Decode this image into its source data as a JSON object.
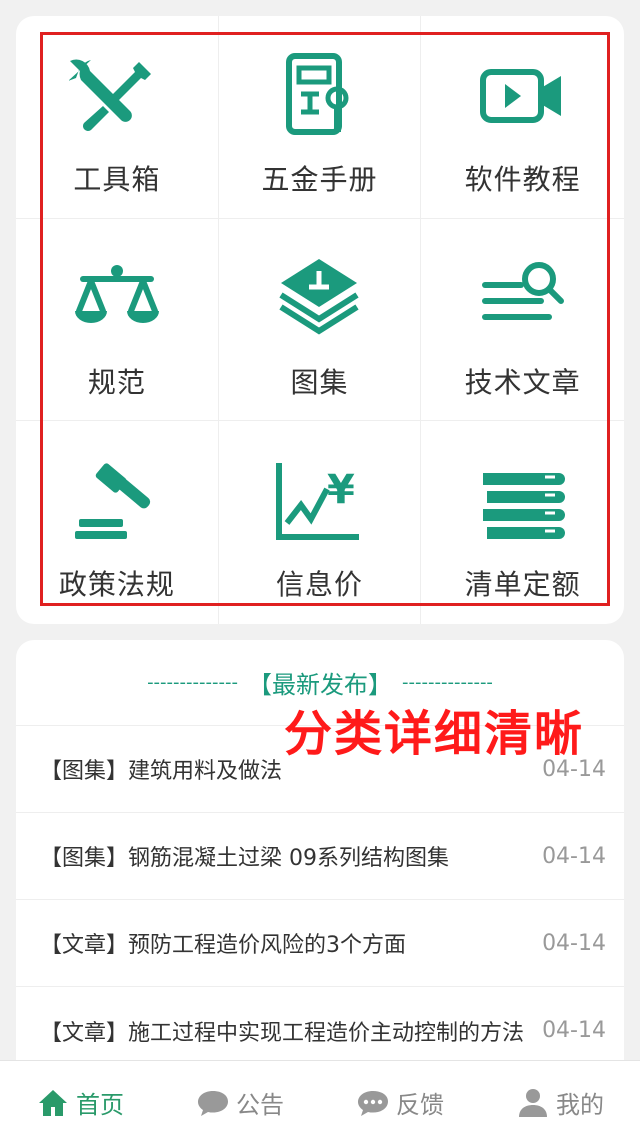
{
  "grid": {
    "items": [
      {
        "label": "工具箱",
        "icon": "toolbox-icon"
      },
      {
        "label": "五金手册",
        "icon": "hardware-manual-icon"
      },
      {
        "label": "软件教程",
        "icon": "video-tutorial-icon"
      },
      {
        "label": "规范",
        "icon": "balance-scale-icon"
      },
      {
        "label": "图集",
        "icon": "layered-atlas-icon"
      },
      {
        "label": "技术文章",
        "icon": "article-search-icon"
      },
      {
        "label": "政策法规",
        "icon": "gavel-icon"
      },
      {
        "label": "信息价",
        "icon": "price-chart-icon"
      },
      {
        "label": "清单定额",
        "icon": "book-stack-icon"
      }
    ]
  },
  "news": {
    "title": "【最新发布】",
    "dashes": "--------------",
    "overlay": "分类详细清晰",
    "items": [
      {
        "text": "【图集】建筑用料及做法",
        "date": "04-14"
      },
      {
        "text": "【图集】钢筋混凝土过梁 09系列结构图集",
        "date": "04-14"
      },
      {
        "text": "【文章】预防工程造价风险的3个方面",
        "date": "04-14"
      },
      {
        "text": "【文章】施工过程中实现工程造价主动控制的方法",
        "date": "04-14"
      }
    ]
  },
  "tabbar": {
    "items": [
      {
        "label": "首页",
        "icon": "home-icon",
        "active": true
      },
      {
        "label": "公告",
        "icon": "chat-bubble-icon",
        "active": false
      },
      {
        "label": "反馈",
        "icon": "feedback-icon",
        "active": false
      },
      {
        "label": "我的",
        "icon": "user-icon",
        "active": false
      }
    ]
  },
  "colors": {
    "accent": "#1b9a7d",
    "overlay_red": "#ff1a1a",
    "frame_red": "#e02020",
    "tab_active": "#2a9a6a",
    "tab_inactive": "#888888"
  }
}
